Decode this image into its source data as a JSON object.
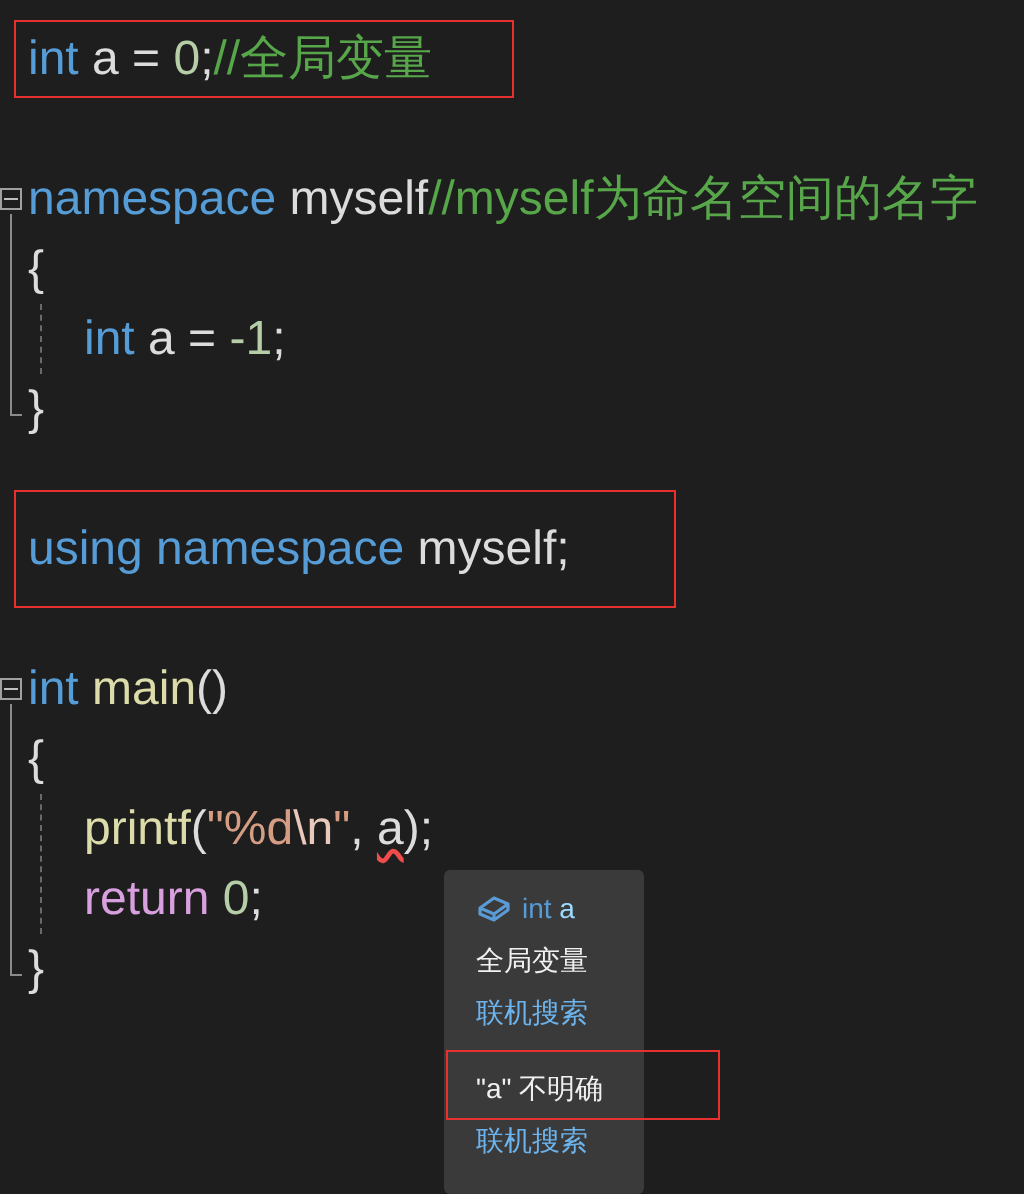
{
  "editor": {
    "items": [
      {
        "kind": "line",
        "highlighted": true,
        "tokens": [
          {
            "text": "int",
            "kind": "keyword"
          },
          {
            "text": " a = ",
            "kind": "plain"
          },
          {
            "text": "0",
            "kind": "number"
          },
          {
            "text": ";",
            "kind": "plain"
          },
          {
            "text": "//全局变量",
            "kind": "comment"
          }
        ]
      },
      {
        "kind": "blank"
      },
      {
        "kind": "block",
        "expanded": true,
        "header": [
          {
            "text": "namespace",
            "kind": "keyword"
          },
          {
            "text": " myself",
            "kind": "plain"
          },
          {
            "text": "//myself为命名空间的名字",
            "kind": "comment"
          }
        ],
        "open": "{",
        "close": "}",
        "body": [
          {
            "kind": "line",
            "highlighted": false,
            "tokens": [
              {
                "text": "int",
                "kind": "keyword"
              },
              {
                "text": " a = ",
                "kind": "plain"
              },
              {
                "text": "-1",
                "kind": "number"
              },
              {
                "text": ";",
                "kind": "plain"
              }
            ]
          }
        ]
      },
      {
        "kind": "blank"
      },
      {
        "kind": "line",
        "highlighted": true,
        "tokens": [
          {
            "text": "using namespace",
            "kind": "keyword"
          },
          {
            "text": " myself;",
            "kind": "plain"
          }
        ]
      },
      {
        "kind": "blank"
      },
      {
        "kind": "block",
        "expanded": true,
        "header": [
          {
            "text": "int",
            "kind": "keyword"
          },
          {
            "text": " main",
            "kind": "function"
          },
          {
            "text": "()",
            "kind": "plain"
          }
        ],
        "open": "{",
        "close": "}",
        "body": [
          {
            "kind": "line",
            "highlighted": false,
            "tokens": [
              {
                "text": "printf",
                "kind": "function"
              },
              {
                "text": "(",
                "kind": "plain"
              },
              {
                "text": "\"%d",
                "kind": "string"
              },
              {
                "text": "\\n",
                "kind": "escape"
              },
              {
                "text": "\"",
                "kind": "string"
              },
              {
                "text": ", ",
                "kind": "plain"
              },
              {
                "text": "a",
                "kind": "error"
              },
              {
                "text": ");",
                "kind": "plain"
              }
            ]
          },
          {
            "kind": "line",
            "highlighted": false,
            "tokens": [
              {
                "text": "return",
                "kind": "control"
              },
              {
                "text": " 0",
                "kind": "number"
              },
              {
                "text": ";",
                "kind": "plain"
              }
            ]
          }
        ]
      }
    ]
  },
  "tooltip": {
    "sections": [
      {
        "items": [
          {
            "kind": "signature",
            "keyword": "int",
            "name": "a",
            "highlighted": false
          },
          {
            "kind": "text",
            "text": "全局变量",
            "highlighted": false
          },
          {
            "kind": "link",
            "text": "联机搜索",
            "highlighted": false
          }
        ]
      },
      {
        "items": [
          {
            "kind": "text",
            "text": "\"a\" 不明确",
            "highlighted": true
          },
          {
            "kind": "link",
            "text": "联机搜索",
            "highlighted": false
          }
        ]
      }
    ]
  }
}
